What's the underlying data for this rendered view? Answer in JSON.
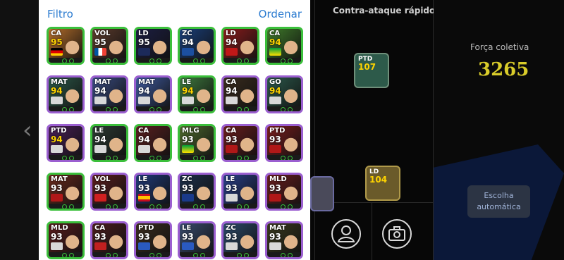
{
  "header": {
    "filter_label": "Filtro",
    "sort_label": "Ordenar"
  },
  "cards": [
    {
      "pos": "CA",
      "rating": "95",
      "frame": "#3bbf3b",
      "bg": "#b46d2a",
      "rating_color": "#ffd400",
      "badge": "germany"
    },
    {
      "pos": "VOL",
      "rating": "95",
      "frame": "#3bbf3b",
      "bg": "#5c3b2c",
      "rating_color": "#ffffff",
      "badge": "france"
    },
    {
      "pos": "LD",
      "rating": "95",
      "frame": "#3bbf3b",
      "bg": "#1c1e43",
      "rating_color": "#ffffff",
      "badge": "psg"
    },
    {
      "pos": "ZC",
      "rating": "94",
      "frame": "#3bbf3b",
      "bg": "#1a3f7a",
      "rating_color": "#ffffff",
      "badge": "porto"
    },
    {
      "pos": "LD",
      "rating": "94",
      "frame": "#3bbf3b",
      "bg": "#8a1c1c",
      "rating_color": "#ffffff",
      "badge": "arsenal"
    },
    {
      "pos": "CA",
      "rating": "94",
      "frame": "#3bbf3b",
      "bg": "#3f7b2a",
      "rating_color": "#ffd400",
      "badge": "brazil"
    },
    {
      "pos": "MAT",
      "rating": "94",
      "frame": "#9b5fd0",
      "bg": "#2d5a4a",
      "rating_color": "#ffd400",
      "badge": "club"
    },
    {
      "pos": "MAT",
      "rating": "94",
      "frame": "#9b5fd0",
      "bg": "#3a4c82",
      "rating_color": "#ffffff",
      "badge": "club"
    },
    {
      "pos": "MAT",
      "rating": "94",
      "frame": "#9b5fd0",
      "bg": "#3f5a9e",
      "rating_color": "#ffffff",
      "badge": "club"
    },
    {
      "pos": "LE",
      "rating": "94",
      "frame": "#3bbf3b",
      "bg": "#3e7a3e",
      "rating_color": "#ffd400",
      "badge": "club"
    },
    {
      "pos": "CA",
      "rating": "94",
      "frame": "#9b5fd0",
      "bg": "#3a2c1e",
      "rating_color": "#ffffff",
      "badge": "club"
    },
    {
      "pos": "GO",
      "rating": "94",
      "frame": "#9b5fd0",
      "bg": "#2c5a4c",
      "rating_color": "#ffd400",
      "badge": "club"
    },
    {
      "pos": "PTD",
      "rating": "94",
      "frame": "#9b5fd0",
      "bg": "#4a1f58",
      "rating_color": "#ffd400",
      "badge": "club"
    },
    {
      "pos": "LE",
      "rating": "94",
      "frame": "#3bbf3b",
      "bg": "#2c3a32",
      "rating_color": "#ffffff",
      "badge": "club"
    },
    {
      "pos": "CA",
      "rating": "94",
      "frame": "#3bbf3b",
      "bg": "#5a1f1f",
      "rating_color": "#ffffff",
      "badge": "club"
    },
    {
      "pos": "MLG",
      "rating": "93",
      "frame": "#3bbf3b",
      "bg": "#4f6a2e",
      "rating_color": "#ffffff",
      "badge": "brazil"
    },
    {
      "pos": "CA",
      "rating": "93",
      "frame": "#9b5fd0",
      "bg": "#6a1d1d",
      "rating_color": "#ffffff",
      "badge": "flamengo"
    },
    {
      "pos": "PTD",
      "rating": "93",
      "frame": "#9b5fd0",
      "bg": "#7a1c1c",
      "rating_color": "#ffffff",
      "badge": "flamengo"
    },
    {
      "pos": "MAT",
      "rating": "93",
      "frame": "#3bbf3b",
      "bg": "#6a2a1c",
      "rating_color": "#ffffff",
      "badge": "flamengo"
    },
    {
      "pos": "VOL",
      "rating": "93",
      "frame": "#9b5fd0",
      "bg": "#5a1d1d",
      "rating_color": "#ffffff",
      "badge": "manutd"
    },
    {
      "pos": "LE",
      "rating": "93",
      "frame": "#9b5fd0",
      "bg": "#1f3a7a",
      "rating_color": "#ffffff",
      "badge": "spain"
    },
    {
      "pos": "ZC",
      "rating": "93",
      "frame": "#9b5fd0",
      "bg": "#1d2f4a",
      "rating_color": "#ffffff",
      "badge": "inter"
    },
    {
      "pos": "LE",
      "rating": "93",
      "frame": "#9b5fd0",
      "bg": "#2a3f8a",
      "rating_color": "#ffffff",
      "badge": "club"
    },
    {
      "pos": "MLD",
      "rating": "93",
      "frame": "#9b5fd0",
      "bg": "#6a1d1d",
      "rating_color": "#ffffff",
      "badge": "flamengo"
    },
    {
      "pos": "MLD",
      "rating": "93",
      "frame": "#3bbf3b",
      "bg": "#5a1d1d",
      "rating_color": "#ffffff",
      "badge": "club"
    },
    {
      "pos": "CA",
      "rating": "93",
      "frame": "#9b5fd0",
      "bg": "#4a1d1d",
      "rating_color": "#ffffff",
      "badge": "milan"
    },
    {
      "pos": "PTD",
      "rating": "93",
      "frame": "#9b5fd0",
      "bg": "#3a2c1e",
      "rating_color": "#ffffff",
      "badge": "lyon"
    },
    {
      "pos": "LE",
      "rating": "93",
      "frame": "#9b5fd0",
      "bg": "#3a4c6e",
      "rating_color": "#ffffff",
      "badge": "lyon"
    },
    {
      "pos": "ZC",
      "rating": "93",
      "frame": "#9b5fd0",
      "bg": "#2c4a6a",
      "rating_color": "#ffffff",
      "badge": "club"
    },
    {
      "pos": "MAT",
      "rating": "93",
      "frame": "#9b5fd0",
      "bg": "#3a3a1e",
      "rating_color": "#ffffff",
      "badge": "club"
    }
  ],
  "right": {
    "tactics_title": "Contra-ataque rápido",
    "force_label": "Força coletiva",
    "force_value": "3265",
    "auto_button": "Escolha automática",
    "mini_cards": [
      {
        "pos": "PTD",
        "rating": "107"
      },
      {
        "pos": "LD",
        "rating": "104"
      }
    ]
  },
  "colors": {
    "link": "#2b7bd0",
    "force": "#d9cc2a",
    "auto_btn_bg": "#2c3444"
  }
}
